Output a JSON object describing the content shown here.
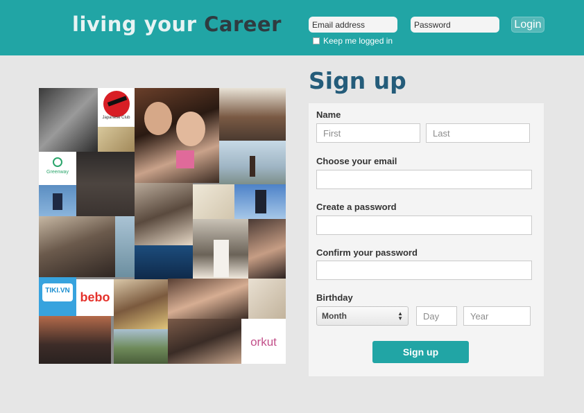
{
  "header": {
    "logo_part1": "living your",
    "logo_part2": "Career",
    "email_placeholder": "Email address",
    "password_placeholder": "Password",
    "login_label": "Login",
    "keep_logged_in_label": "Keep me logged in"
  },
  "collage": {
    "logos": {
      "japanese_club": "Japanese Club",
      "greenway": "Greenway",
      "tiki": "TIKI.VN",
      "bebo": "bebo",
      "orkut": "orkut"
    }
  },
  "signup": {
    "title": "Sign up",
    "name_label": "Name",
    "first_placeholder": "First",
    "last_placeholder": "Last",
    "email_label": "Choose your email",
    "password_label": "Create a password",
    "confirm_label": "Confirm your password",
    "birthday_label": "Birthday",
    "month_value": "Month",
    "day_placeholder": "Day",
    "year_placeholder": "Year",
    "submit_label": "Sign up"
  },
  "colors": {
    "header_bg": "#21a5a5",
    "title": "#245c7a",
    "button": "#21a5a5",
    "page_bg": "#e6e6e6"
  }
}
